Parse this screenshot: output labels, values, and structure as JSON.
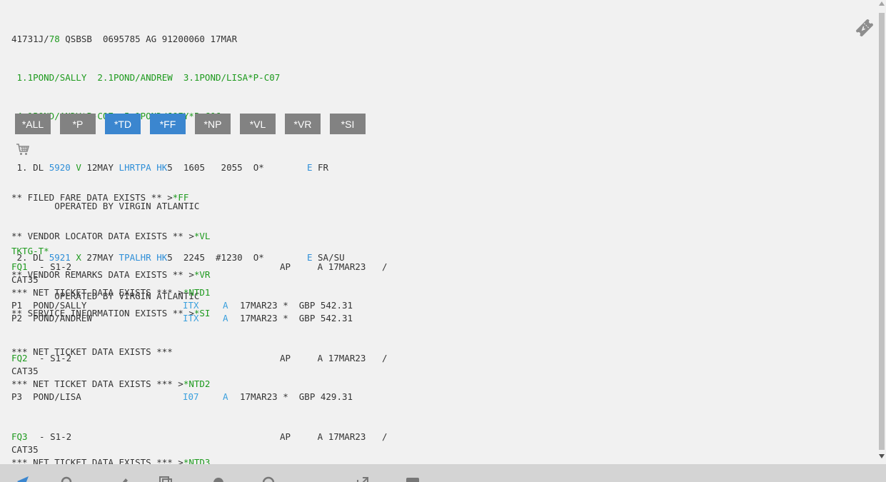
{
  "header": {
    "rec_pre": "41731J/",
    "rec_num": "78",
    "rec_post": " QSBSB  0695785 AG 91200060 17MAR"
  },
  "passengers": {
    "line1": " 1.1POND/SALLY  2.1POND/ANDREW  3.1POND/LISA*P-C07",
    "line2": " 4.1POND/ANDY*P-C07  5.1POND/JOEY*P-C06"
  },
  "segments": [
    {
      "pre": " 1. DL ",
      "flight": "5920",
      "cls": " V",
      "date": " 12MAY ",
      "route": "LHRTPA",
      "sp": " ",
      "hk": "HK",
      "times": "5  1605   2055  O*        ",
      "e": "E",
      "days": " FR",
      "operated": "        OPERATED BY VIRGIN ATLANTIC"
    },
    {
      "pre": " 2. DL ",
      "flight": "5921",
      "cls": " X",
      "date": " 27MAY ",
      "route": "TPALHR",
      "sp": " ",
      "hk": "HK",
      "times": "5  2245  #1230  O*        ",
      "e": "E",
      "days": " SA/SU",
      "operated": "        OPERATED BY VIRGIN ATLANTIC"
    }
  ],
  "buttons": [
    "*ALL",
    "*P",
    "*TD",
    "*FF",
    "*NP",
    "*VL",
    "*VR",
    "*SI"
  ],
  "exists": [
    {
      "text": "** FILED FARE DATA EXISTS ** >",
      "link": "*FF"
    },
    {
      "text": "** VENDOR LOCATOR DATA EXISTS ** >",
      "link": "*VL"
    },
    {
      "text": "** VENDOR REMARKS DATA EXISTS ** >",
      "link": "*VR"
    },
    {
      "text": "** SERVICE INFORMATION EXISTS ** >",
      "link": "*SI"
    },
    {
      "text": "*** NET TICKET DATA EXISTS ***",
      "link": ""
    }
  ],
  "tktg": "TKTG-T*",
  "fares": [
    {
      "fq": "FQ1",
      "seg": "  - S1-2",
      "ap": "AP     A 17MAR23   /",
      "cat": "CAT35",
      "net": "*** NET TICKET DATA EXISTS *** >",
      "ntd": "*NTD1",
      "pax": [
        {
          "p": "P1  POND/SALLY",
          "type": "ITX",
          "a": "A",
          "date": "17MAR23 *  GBP 542.31"
        },
        {
          "p": "P2  POND/ANDREW",
          "type": "ITX",
          "a": "A",
          "date": "17MAR23 *  GBP 542.31"
        }
      ]
    },
    {
      "fq": "FQ2",
      "seg": "  - S1-2",
      "ap": "AP     A 17MAR23   /",
      "cat": "CAT35",
      "net": "*** NET TICKET DATA EXISTS *** >",
      "ntd": "*NTD2",
      "pax": [
        {
          "p": "P3  POND/LISA",
          "type": "I07",
          "a": "A",
          "date": "17MAR23 *  GBP 429.31"
        }
      ]
    },
    {
      "fq": "FQ3",
      "seg": "  - S1-2",
      "ap": "AP     A 17MAR23   /",
      "cat": "CAT35",
      "net": "*** NET TICKET DATA EXISTS *** >",
      "ntd": "*NTD3",
      "pax": []
    }
  ],
  "icons": {
    "cart": "shopping-cart-icon",
    "ticket": "ticket-icon"
  },
  "colors": {
    "green": "#1e9a1e",
    "blue": "#2f8fd8",
    "button_gray": "#828282",
    "button_active": "#3b86cf"
  }
}
